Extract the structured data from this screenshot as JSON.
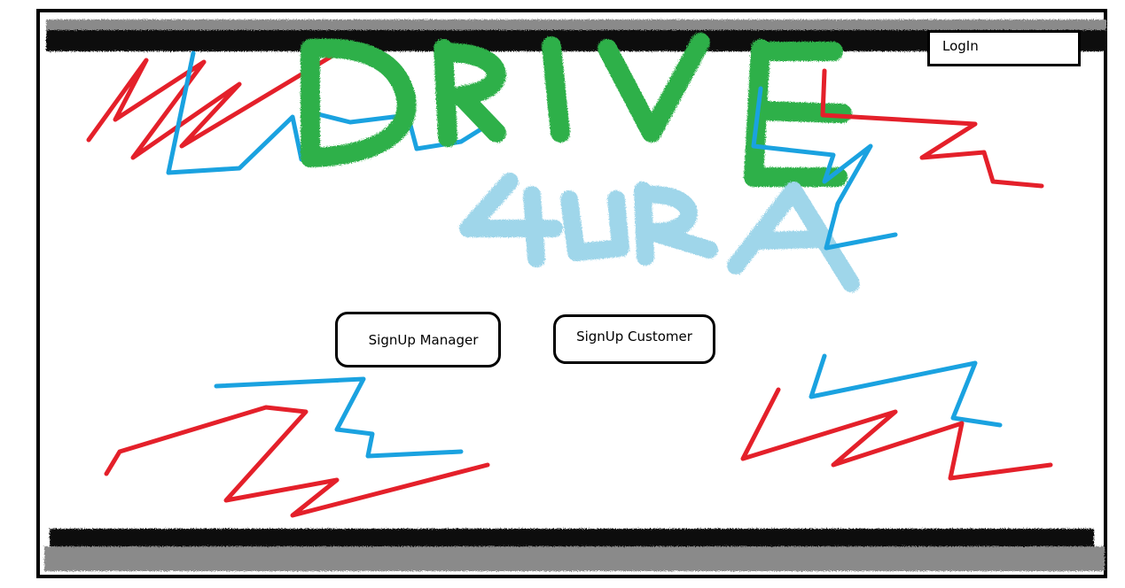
{
  "brand": {
    "logo_text_top": "DRIVE",
    "logo_text_bottom": "4URA"
  },
  "buttons": {
    "login": "LogIn",
    "signup_manager": "SignUp Manager",
    "signup_customer": "SignUp Customer"
  },
  "colors": {
    "frame": "#000000",
    "scribble_red": "#e4202a",
    "scribble_blue": "#1aa2e0",
    "logo_green": "#2fb04a",
    "logo_lightblue": "#9fd6ea",
    "bar_black": "#111111",
    "bar_gray": "#8a8a8a"
  }
}
